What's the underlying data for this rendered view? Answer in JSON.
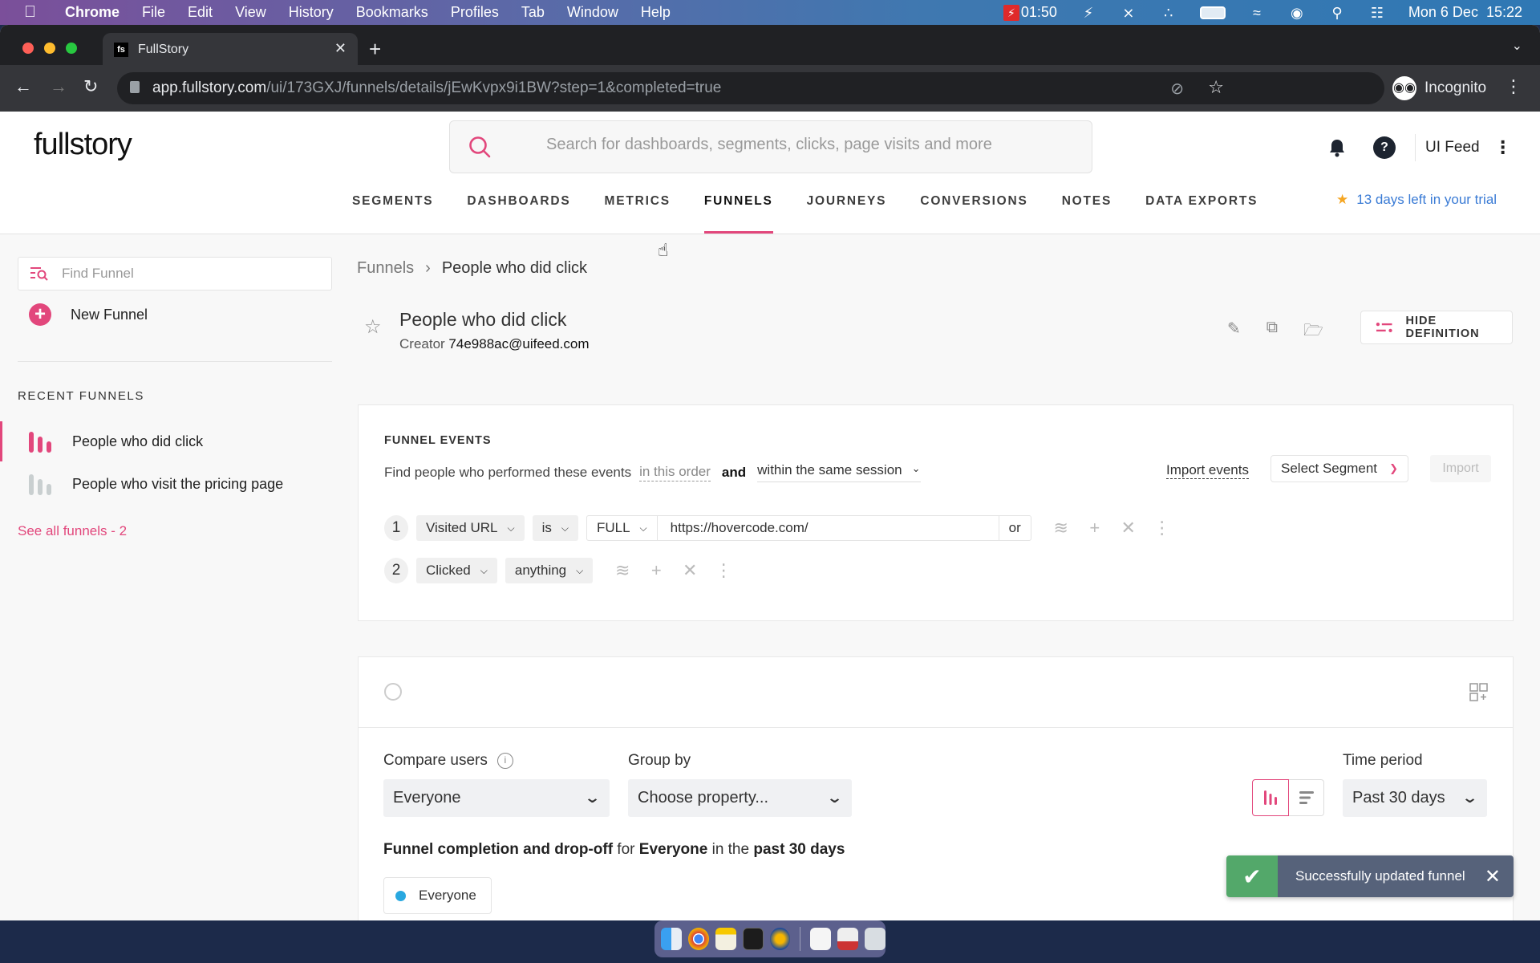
{
  "menubar": {
    "app": "Chrome",
    "items": [
      "File",
      "Edit",
      "View",
      "History",
      "Bookmarks",
      "Profiles",
      "Tab",
      "Window",
      "Help"
    ],
    "recording_time": "01:50",
    "datetime": "Mon 6 Dec  15:22",
    "tray_icons": [
      "recording-icon",
      "lightning-icon",
      "bluetooth-off-icon",
      "keyboard-brightness-icon",
      "battery-icon",
      "wifi-icon",
      "user-icon",
      "spotlight-icon",
      "control-center-icon"
    ]
  },
  "browser": {
    "tab_title": "FullStory",
    "tab_favicon": "fs",
    "url_host": "app.fullstory.com",
    "url_path": "/ui/173GXJ/funnels/details/jEwKvpx9i1BW?step=1&completed=true",
    "profile_label": "Incognito"
  },
  "header": {
    "logo": "fullstory",
    "search_placeholder": "Search for dashboards, segments, clicks, page visits and more",
    "account": "UI Feed",
    "help_label": "?",
    "nav": [
      {
        "label": "SEGMENTS",
        "active": false
      },
      {
        "label": "DASHBOARDS",
        "active": false
      },
      {
        "label": "METRICS",
        "active": false
      },
      {
        "label": "FUNNELS",
        "active": true
      },
      {
        "label": "JOURNEYS",
        "active": false
      },
      {
        "label": "CONVERSIONS",
        "active": false
      },
      {
        "label": "NOTES",
        "active": false
      },
      {
        "label": "DATA EXPORTS",
        "active": false
      }
    ],
    "trial": "13 days left in your trial"
  },
  "sidebar": {
    "find_placeholder": "Find Funnel",
    "new_funnel": "New Funnel",
    "recent_heading": "RECENT FUNNELS",
    "recent": [
      {
        "label": "People who did click",
        "active": true
      },
      {
        "label": "People who visit the pricing page",
        "active": false
      }
    ],
    "see_all": "See all funnels - 2"
  },
  "main": {
    "breadcrumb": {
      "root": "Funnels",
      "current": "People who did click"
    },
    "title": "People who did click",
    "creator_label": "Creator",
    "creator_email": "74e988ac@uifeed.com",
    "hide_definition": "HIDE DEFINITION",
    "funnel_events": {
      "heading": "FUNNEL EVENTS",
      "sentence_prefix": "Find people who performed these events",
      "order": "in this order",
      "and": "and",
      "session": "within the same session",
      "import_events": "Import events",
      "select_segment": "Select Segment",
      "import_button": "Import",
      "steps": [
        {
          "num": "1",
          "event": "Visited URL",
          "operator": "is",
          "match": "FULL",
          "value": "https://hovercode.com/",
          "or": "or"
        },
        {
          "num": "2",
          "event": "Clicked",
          "operator": "anything"
        }
      ]
    },
    "results": {
      "compare_label": "Compare users",
      "compare_value": "Everyone",
      "group_label": "Group by",
      "group_value": "Choose property...",
      "time_label": "Time period",
      "time_value": "Past 30 days",
      "summary": {
        "part1": "Funnel completion and drop-off",
        "part2": " for ",
        "part3": "Everyone",
        "part4": " in the ",
        "part5": "past 30 days"
      },
      "legend": [
        {
          "label": "Everyone",
          "color": "#29a8e0"
        }
      ]
    }
  },
  "toast": {
    "message": "Successfully updated funnel"
  },
  "colors": {
    "accent": "#e2477c",
    "link": "#3a7bd5",
    "toast_success": "#53a86a",
    "toast_bg": "#56627a"
  }
}
